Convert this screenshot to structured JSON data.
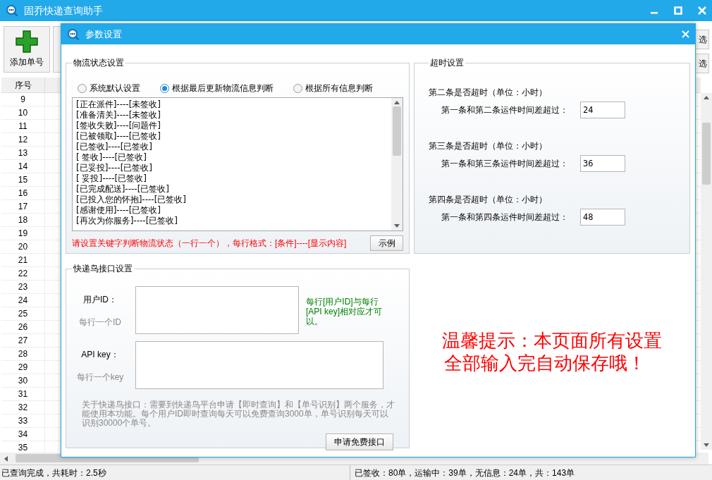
{
  "app": {
    "title": "固乔快递查询助手"
  },
  "toolbar": {
    "add_button": "添加单号",
    "right_buttons": [
      "选",
      "选"
    ]
  },
  "table": {
    "columns": [
      "序号"
    ],
    "rows": [
      "9",
      "10",
      "11",
      "12",
      "13",
      "14",
      "15",
      "16",
      "17",
      "18",
      "19",
      "20",
      "21",
      "22",
      "23",
      "24",
      "25",
      "26",
      "27",
      "28",
      "29",
      "30",
      "31",
      "32",
      "33",
      "34",
      "35"
    ]
  },
  "status_bar": {
    "left": "已查询完成，共耗时：2.5秒",
    "right": "已签收：80单，运输中：39单，无信息：24单，共：143单"
  },
  "dialog": {
    "title": "参数设置",
    "logistics": {
      "legend": "物流状态设置",
      "modes": [
        {
          "label": "系统默认设置",
          "selected": false
        },
        {
          "label": "根据最后更新物流信息判断",
          "selected": true
        },
        {
          "label": "根据所有信息判断",
          "selected": false
        }
      ],
      "rules": [
        "[正在派件]----[未签收]",
        "[准备清关]----[未签收]",
        "[签收失败]----[问题件]",
        "[已被领取]----[已签收]",
        "[已签收]----[已签收]",
        "[ 签收]----[已签收]",
        "[已妥投]----[已签收]",
        "[ 妥投]----[已签收]",
        "[已完成配送]----[已签收]",
        "[已投入您的怀抱]----[已签收]",
        "[感谢使用]----[已签收]",
        "[再次为你服务]----[已签收]"
      ],
      "hint": "请设置关键字判断物流状态（一行一个），每行格式：[条件]----[显示内容]",
      "example_button": "示例"
    },
    "timeout": {
      "legend": "超时设置",
      "items": [
        {
          "heading": "第二条是否超时（单位：小时）",
          "label": "第一条和第二条运件时间差超过：",
          "value": "24"
        },
        {
          "heading": "第三条是否超时（单位：小时）",
          "label": "第一条和第三条运件时间差超过：",
          "value": "36"
        },
        {
          "heading": "第四条是否超时（单位：小时）",
          "label": "第一条和第四条运件时间差超过：",
          "value": "48"
        }
      ]
    },
    "kdniao": {
      "legend": "快递鸟接口设置",
      "user_id_label": "用户ID：",
      "user_id_hint": "每行一个ID",
      "note": "每行[用户ID]与每行[API key]相对应才可以。",
      "api_key_label": "API key：",
      "api_key_hint": "每行一个key",
      "about": "关于快递鸟接口：需要到快递鸟平台申请【即时查询】和【单号识别】两个服务，才能使用本功能。每个用户ID即时查询每天可以免费查询3000单，单号识别每天可以识别30000个单号。",
      "apply_button": "申请免费接口"
    },
    "tip": [
      "温馨提示：本页面所有设置",
      "全部输入完自动保存哦！"
    ]
  }
}
